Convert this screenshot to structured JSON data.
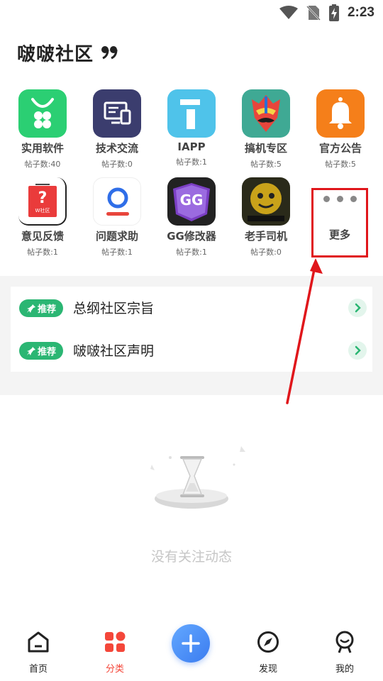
{
  "status": {
    "time": "2:23"
  },
  "header": {
    "title": "啵啵社区"
  },
  "categories": [
    {
      "name": "实用软件",
      "count": "帖子数:40",
      "icon": "bag-icon",
      "color": "#2bcf73"
    },
    {
      "name": "技术交流",
      "count": "帖子数:0",
      "icon": "computer-icon",
      "color": "#3b3d6e"
    },
    {
      "name": "IAPP",
      "count": "帖子数:1",
      "icon": "info-i-icon",
      "color": "#4fc3ea"
    },
    {
      "name": "搞机专区",
      "count": "帖子数:5",
      "icon": "mask-icon",
      "color": "#3fa994"
    },
    {
      "name": "官方公告",
      "count": "帖子数:5",
      "icon": "bell-icon",
      "color": "#f57f1a"
    },
    {
      "name": "意见反馈",
      "count": "帖子数:1",
      "icon": "feedback-bag-icon",
      "color": "#ea3b3b",
      "sublabel": "W社区"
    },
    {
      "name": "问题求助",
      "count": "帖子数:1",
      "icon": "help-person-icon",
      "color": "#2f6ee8"
    },
    {
      "name": "GG修改器",
      "count": "帖子数:1",
      "icon": "gg-logo-icon",
      "color": "#7b3fc4",
      "logo_text": "GG"
    },
    {
      "name": "老手司机",
      "count": "帖子数:0",
      "icon": "meme-face-icon",
      "color": "#c9a21a"
    }
  ],
  "more": {
    "label": "更多"
  },
  "recommended": {
    "badge": "推荐",
    "items": [
      {
        "text": "总纲社区宗旨"
      },
      {
        "text": "啵啵社区声明"
      }
    ]
  },
  "empty": {
    "text": "没有关注动态"
  },
  "nav": {
    "items": [
      {
        "label": "首页"
      },
      {
        "label": "分类"
      },
      {
        "label": "发现"
      },
      {
        "label": "我的"
      }
    ],
    "active": "分类"
  },
  "colors": {
    "accent_green": "#2bb673",
    "active_nav": "#f4473a",
    "fab_blue": "#3b7cf0",
    "annotation_red": "#e0161b"
  }
}
